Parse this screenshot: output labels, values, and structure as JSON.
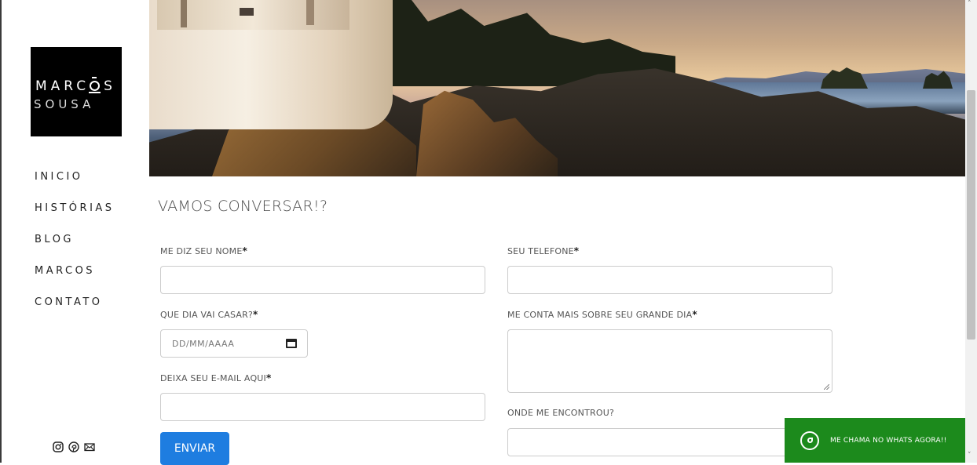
{
  "brand": {
    "line1_pre": "MARC",
    "line1_post": "S",
    "line2": "SOUSA"
  },
  "nav": {
    "items": [
      "INICIO",
      "HISTÓRIAS",
      "BLOG",
      "MARCOS",
      "CONTATO"
    ]
  },
  "social": {
    "icons": [
      "instagram-icon",
      "pinterest-icon",
      "mail-icon"
    ]
  },
  "hero": {
    "image": "lighthouse-coast-sunset"
  },
  "form": {
    "title": "VAMOS CONVERSAR!?",
    "name_label": "ME DIZ SEU NOME",
    "date_label": "QUE DIA VAI CASAR?",
    "date_placeholder": "DD/MM/AAAA",
    "email_label": "DEIXA SEU E-MAIL AQUI",
    "phone_label": "SEU TELEFONE",
    "details_label": "ME CONTA MAIS SOBRE SEU GRANDE DIA",
    "source_label": "ONDE ME ENCONTROU?",
    "required_mark": "*",
    "submit_label": "ENVIAR"
  },
  "whatsapp": {
    "label": "ME CHAMA NO WHATS AGORA!!",
    "color": "#1c8a1c"
  },
  "colors": {
    "accent": "#1e7de0",
    "logo_bg": "#000000"
  }
}
